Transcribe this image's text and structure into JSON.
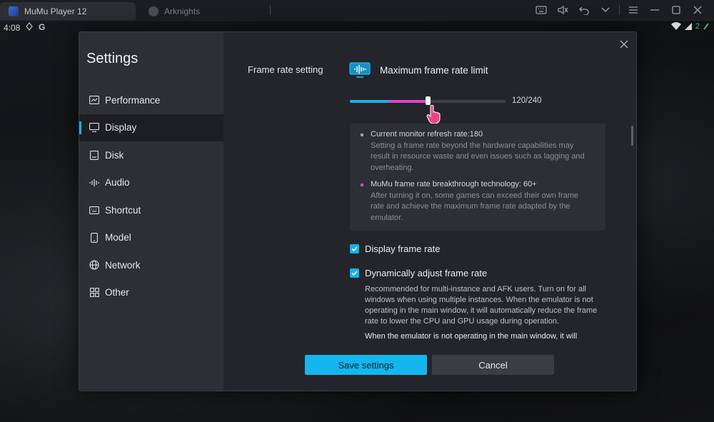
{
  "titlebar": {
    "tabs": [
      {
        "label": "MuMu Player 12",
        "active": true
      },
      {
        "label": "Arknights",
        "active": false
      }
    ],
    "icons": [
      "keyboard-icon",
      "mute-icon",
      "back-icon",
      "chevron-down-icon",
      "menu-icon",
      "minimize-icon",
      "maximize-icon",
      "close-icon"
    ]
  },
  "statusbar": {
    "time": "4:08",
    "battery_text": "2"
  },
  "settings": {
    "title": "Settings",
    "nav": [
      {
        "label": "Performance",
        "icon": "chart-icon"
      },
      {
        "label": "Display",
        "icon": "monitor-icon",
        "active": true
      },
      {
        "label": "Disk",
        "icon": "disk-icon"
      },
      {
        "label": "Audio",
        "icon": "audio-wave-icon"
      },
      {
        "label": "Shortcut",
        "icon": "keyboard-icon"
      },
      {
        "label": "Model",
        "icon": "phone-icon"
      },
      {
        "label": "Network",
        "icon": "globe-icon"
      },
      {
        "label": "Other",
        "icon": "grid-icon"
      }
    ]
  },
  "display": {
    "frame_rate_label": "Frame rate setting",
    "max_frame_title": "Maximum frame rate limit",
    "slider": {
      "value": 120,
      "max": 240,
      "text": "120/240"
    },
    "info": [
      {
        "title": "Current monitor refresh rate:180",
        "desc": "Setting a frame rate beyond the hardware capabilities may result in resource waste and even issues such as lagging and overheating.",
        "bullet_color": "#9aa0a6"
      },
      {
        "title": "MuMu frame rate breakthrough technology: 60+",
        "desc": "After turning it on, some games can exceed their own frame rate and achieve the maximum frame rate adapted by the emulator.",
        "bullet_color": "#e541c9"
      }
    ],
    "display_frame_rate": {
      "label": "Display frame rate",
      "checked": true
    },
    "dynamic_frame_rate": {
      "label": "Dynamically adjust frame rate",
      "checked": true,
      "desc": "Recommended for multi-instance and AFK users. Turn on for all windows when using multiple instances. When the emulator is not operating in the main window, it will automatically reduce the frame rate to lower the CPU and GPU usage during operation.",
      "more": "When the emulator is not operating in the main window, it will"
    }
  },
  "buttons": {
    "save": "Save settings",
    "cancel": "Cancel"
  },
  "colors": {
    "accent": "#13b6ee",
    "magenta": "#e541c9"
  }
}
